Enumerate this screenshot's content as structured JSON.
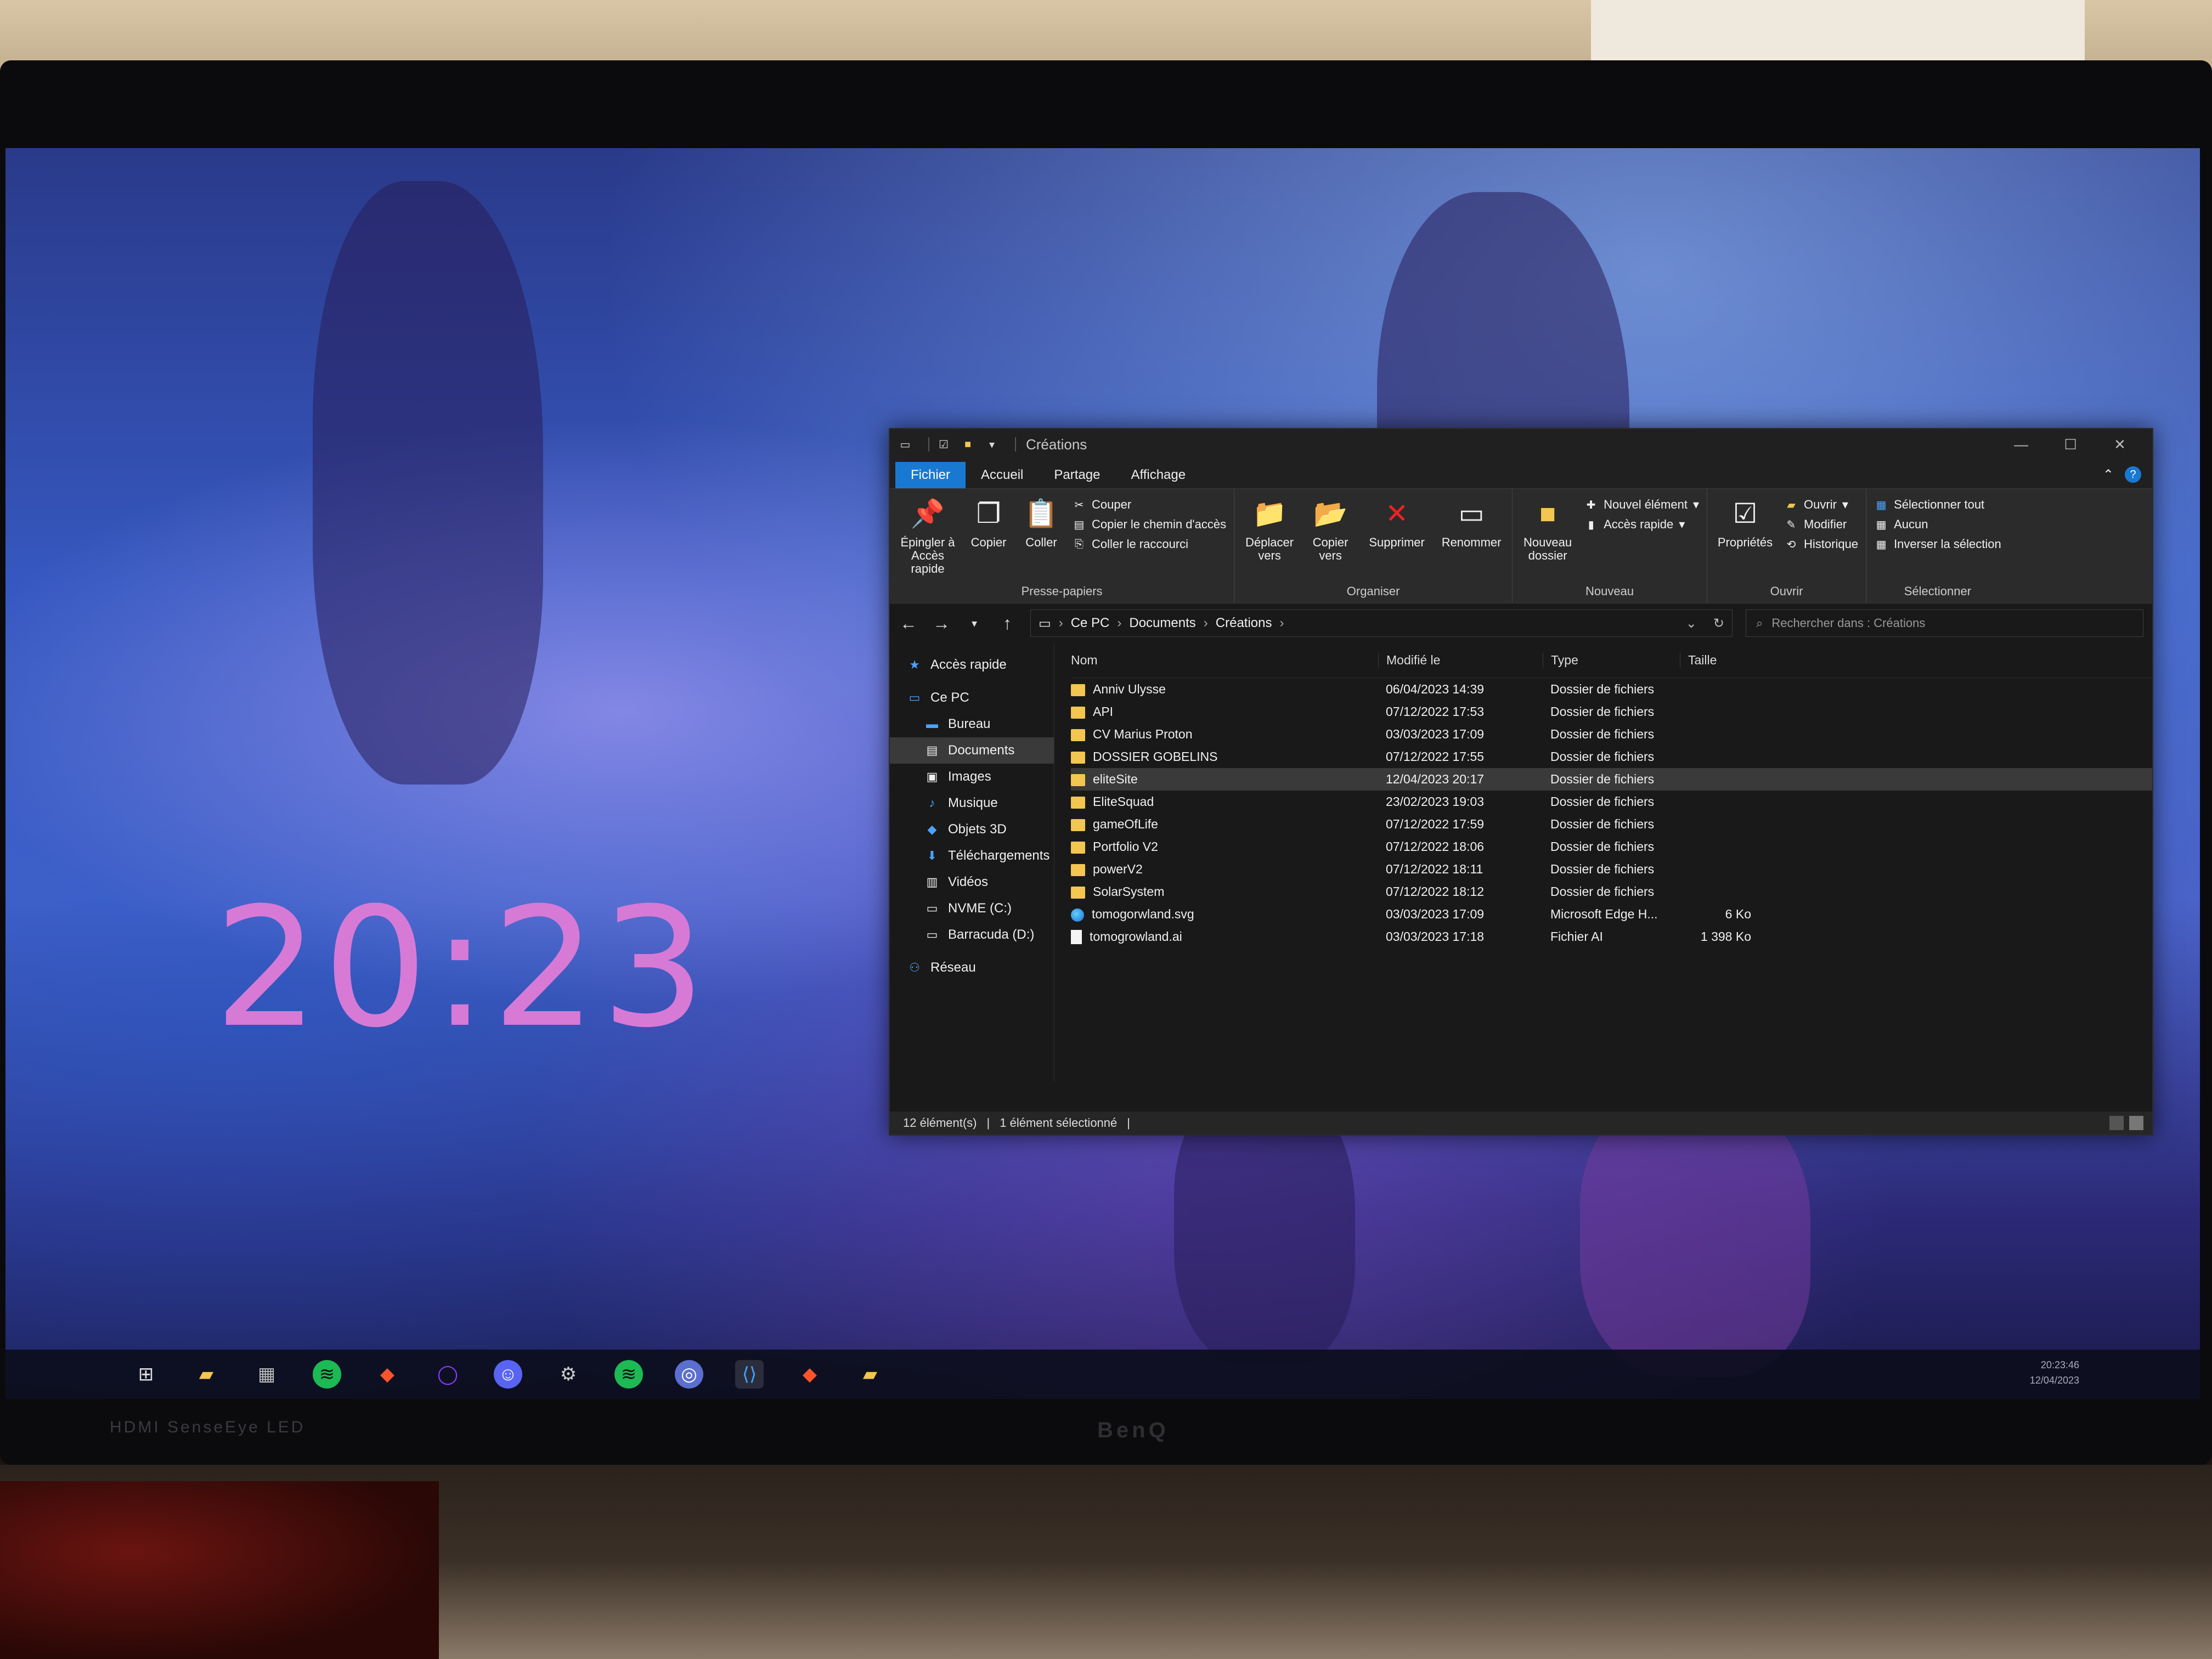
{
  "clock_widget": {
    "time": "20:23"
  },
  "window": {
    "title": "Créations",
    "tabs": [
      {
        "label": "Fichier",
        "active": true
      },
      {
        "label": "Accueil"
      },
      {
        "label": "Partage"
      },
      {
        "label": "Affichage"
      }
    ]
  },
  "ribbon": {
    "presse_papiers": {
      "label": "Presse-papiers",
      "pin": "Épingler à Accès rapide",
      "copy": "Copier",
      "paste": "Coller",
      "cut": "Couper",
      "copy_path": "Copier le chemin d'accès",
      "paste_shortcut": "Coller le raccourci"
    },
    "organiser": {
      "label": "Organiser",
      "move": "Déplacer vers",
      "copy_to": "Copier vers",
      "delete": "Supprimer",
      "rename": "Renommer"
    },
    "nouveau": {
      "label": "Nouveau",
      "new_folder": "Nouveau dossier",
      "new_item": "Nouvel élément",
      "quick_access": "Accès rapide"
    },
    "ouvrir": {
      "label": "Ouvrir",
      "properties": "Propriétés",
      "open": "Ouvrir",
      "edit": "Modifier",
      "history": "Historique"
    },
    "selectionner": {
      "label": "Sélectionner",
      "select_all": "Sélectionner tout",
      "none": "Aucun",
      "invert": "Inverser la sélection"
    }
  },
  "address": {
    "crumbs": [
      "Ce PC",
      "Documents",
      "Créations"
    ],
    "search_placeholder": "Rechercher dans : Créations"
  },
  "nav": [
    {
      "label": "Accès rapide",
      "icon": "star-icon"
    },
    {
      "label": "Ce PC",
      "icon": "computer-icon"
    },
    {
      "label": "Bureau",
      "icon": "desktop-icon"
    },
    {
      "label": "Documents",
      "icon": "documents-icon"
    },
    {
      "label": "Images",
      "icon": "images-icon"
    },
    {
      "label": "Musique",
      "icon": "music-icon"
    },
    {
      "label": "Objets 3D",
      "icon": "cube-icon"
    },
    {
      "label": "Téléchargements",
      "icon": "download-icon"
    },
    {
      "label": "Vidéos",
      "icon": "video-icon"
    },
    {
      "label": "NVME (C:)",
      "icon": "drive-icon"
    },
    {
      "label": "Barracuda (D:)",
      "icon": "drive-icon"
    },
    {
      "label": "Réseau",
      "icon": "network-icon"
    }
  ],
  "columns": {
    "name": "Nom",
    "date": "Modifié le",
    "type": "Type",
    "size": "Taille"
  },
  "files": [
    {
      "name": "Anniv Ulysse",
      "date": "06/04/2023 14:39",
      "type": "Dossier de fichiers",
      "size": "",
      "kind": "folder"
    },
    {
      "name": "API",
      "date": "07/12/2022 17:53",
      "type": "Dossier de fichiers",
      "size": "",
      "kind": "folder"
    },
    {
      "name": "CV Marius Proton",
      "date": "03/03/2023 17:09",
      "type": "Dossier de fichiers",
      "size": "",
      "kind": "folder"
    },
    {
      "name": "DOSSIER GOBELINS",
      "date": "07/12/2022 17:55",
      "type": "Dossier de fichiers",
      "size": "",
      "kind": "folder"
    },
    {
      "name": "eliteSite",
      "date": "12/04/2023 20:17",
      "type": "Dossier de fichiers",
      "size": "",
      "kind": "folder",
      "selected": true
    },
    {
      "name": "EliteSquad",
      "date": "23/02/2023 19:03",
      "type": "Dossier de fichiers",
      "size": "",
      "kind": "folder"
    },
    {
      "name": "gameOfLife",
      "date": "07/12/2022 17:59",
      "type": "Dossier de fichiers",
      "size": "",
      "kind": "folder"
    },
    {
      "name": "Portfolio V2",
      "date": "07/12/2022 18:06",
      "type": "Dossier de fichiers",
      "size": "",
      "kind": "folder"
    },
    {
      "name": "powerV2",
      "date": "07/12/2022 18:11",
      "type": "Dossier de fichiers",
      "size": "",
      "kind": "folder"
    },
    {
      "name": "SolarSystem",
      "date": "07/12/2022 18:12",
      "type": "Dossier de fichiers",
      "size": "",
      "kind": "folder"
    },
    {
      "name": "tomogorwland.svg",
      "date": "03/03/2023 17:09",
      "type": "Microsoft Edge H...",
      "size": "6 Ko",
      "kind": "edge"
    },
    {
      "name": "tomogrowland.ai",
      "date": "03/03/2023 17:18",
      "type": "Fichier AI",
      "size": "1 398 Ko",
      "kind": "file"
    }
  ],
  "status": {
    "count": "12 élément(s)",
    "selection": "1 élément sélectionné"
  },
  "taskbar": {
    "apps": [
      "start-icon",
      "file-explorer-icon",
      "task-manager-icon",
      "spotify-icon",
      "brave-icon",
      "cortana-icon",
      "discord-icon",
      "steam-icon",
      "spotify-icon",
      "chrome-icon",
      "vscode-icon",
      "brave-icon",
      "file-explorer-icon"
    ],
    "time": "20:23:46",
    "date": "12/04/2023"
  },
  "monitor": {
    "brand": "BenQ",
    "label_left": "HDMI SenseEye LED"
  }
}
